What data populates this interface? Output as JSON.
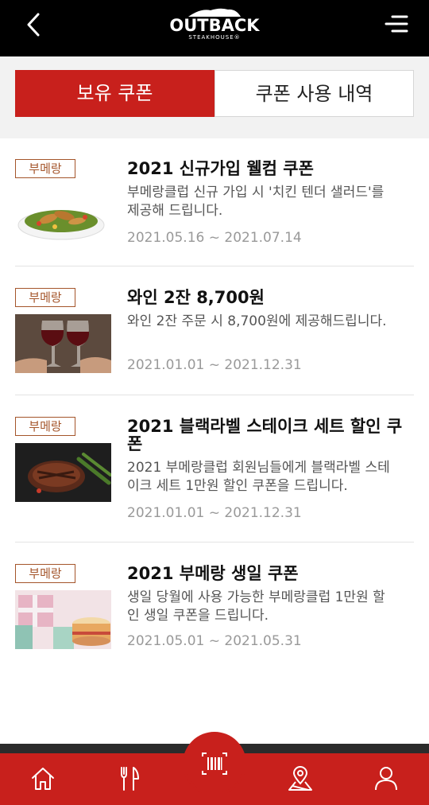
{
  "header": {
    "logo_main": "OUTBACK",
    "logo_sub": "STEAKHOUSE®",
    "icons": [
      "back-icon",
      "menu-icon"
    ]
  },
  "tabs": [
    {
      "label": "보유 쿠폰",
      "active": true
    },
    {
      "label": "쿠폰 사용 내역",
      "active": false
    }
  ],
  "coupons": [
    {
      "badge": "부메랑",
      "title": "2021 신규가입 웰컴 쿠폰",
      "desc_line1": "부메랑클럽 신규 가입 시 '치킨 텐더 샐러드'를",
      "desc_line2": "제공해 드립니다.",
      "date": "2021.05.16 ~ 2021.07.14",
      "image": "chicken-tender-salad"
    },
    {
      "badge": "부메랑",
      "title": "와인 2잔 8,700원",
      "desc_line1": "와인 2잔 주문 시 8,700원에 제공해드립니다.",
      "desc_line2": "",
      "date": "2021.01.01 ~ 2021.12.31",
      "image": "red-wine-glasses"
    },
    {
      "badge": "부메랑",
      "title_line1": "2021 블랙라벨 스테이크 세트 할인 쿠",
      "title_line2": "폰",
      "desc_line1": "2021 부메랑클럽 회원님들에게 블랙라벨 스테",
      "desc_line2": "이크 세트 1만원 할인 쿠폰을 드립니다.",
      "date": "2021.01.01 ~ 2021.12.31",
      "image": "steak"
    },
    {
      "badge": "부메랑",
      "title": "2021 부메랑 생일 쿠폰",
      "desc_line1": "생일 당월에 사용 가능한 부메랑클럽 1만원 할",
      "desc_line2": "인 생일 쿠폰을 드립니다.",
      "date": "2021.05.01 ~ 2021.05.31",
      "image": "birthday-cake"
    }
  ],
  "bottom_nav": {
    "items": [
      "home-icon",
      "restaurant-icon",
      "barcode-scan-icon",
      "location-icon",
      "user-icon"
    ]
  },
  "colors": {
    "brand_red": "#c8201c",
    "badge_brown": "#a4552b",
    "header_black": "#000000"
  }
}
